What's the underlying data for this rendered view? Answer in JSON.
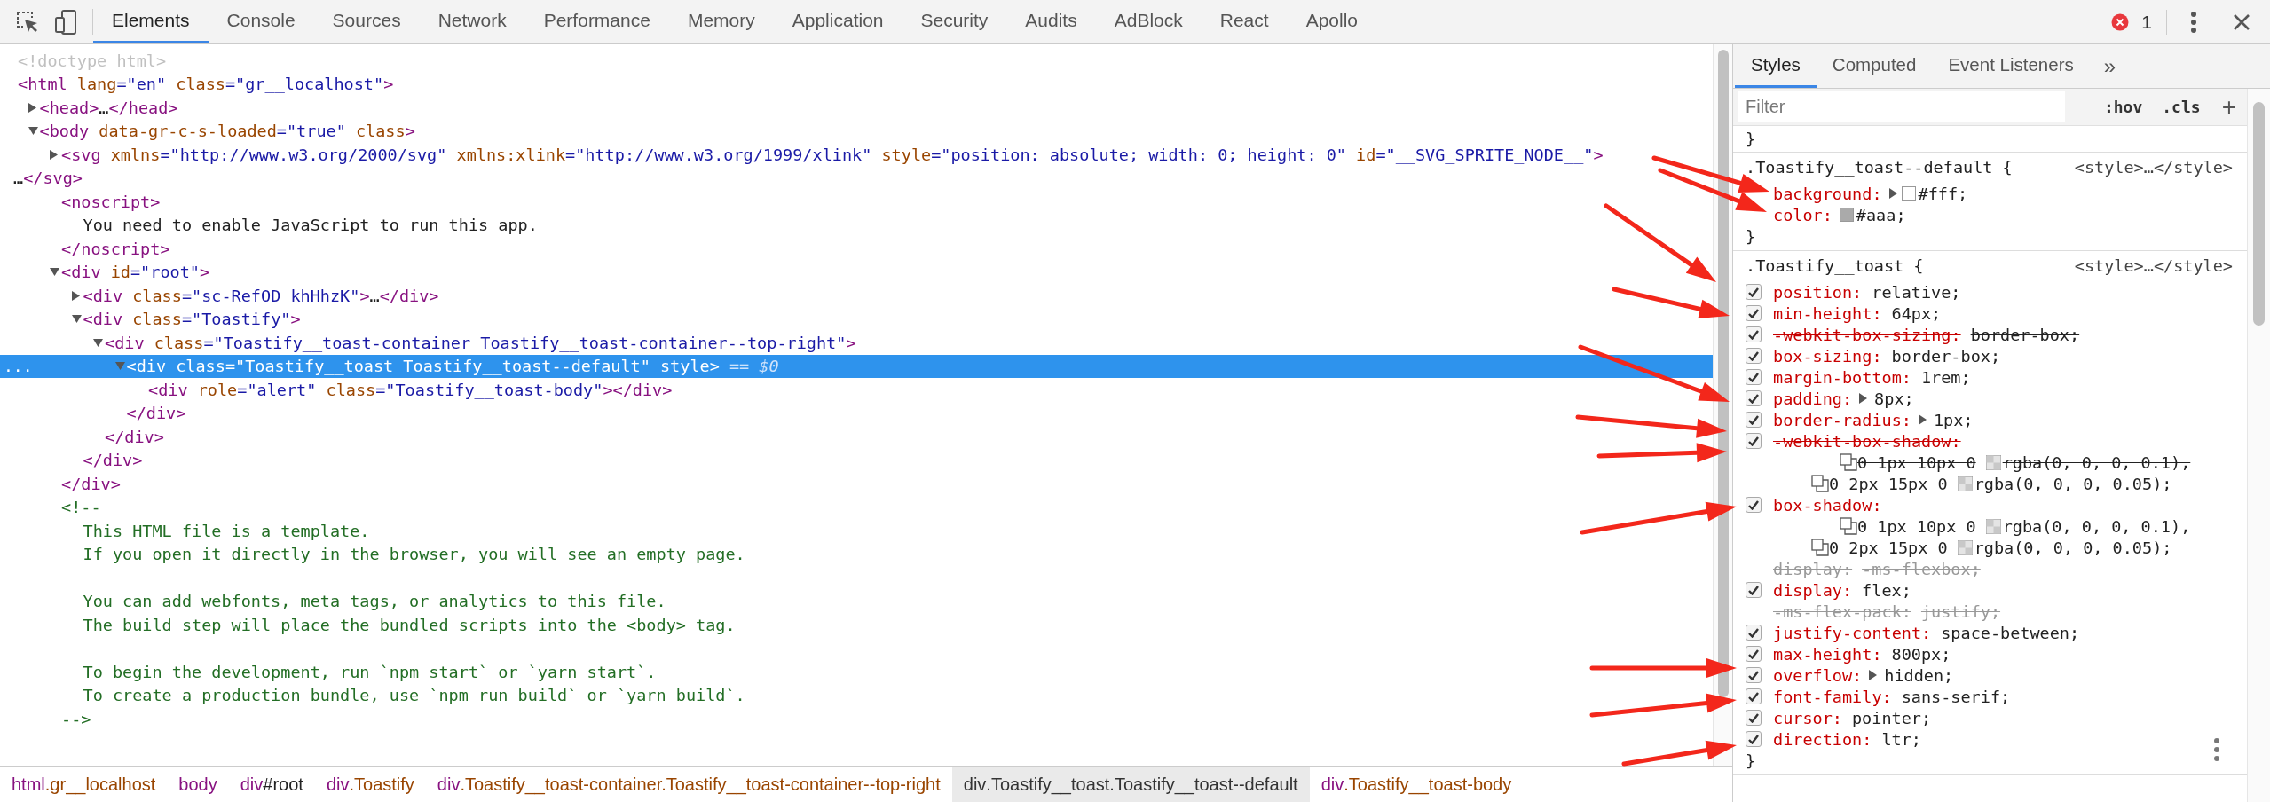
{
  "toolbar": {
    "tabs": [
      {
        "label": "Elements",
        "selected": true
      },
      {
        "label": "Console",
        "selected": false
      },
      {
        "label": "Sources",
        "selected": false
      },
      {
        "label": "Network",
        "selected": false
      },
      {
        "label": "Performance",
        "selected": false
      },
      {
        "label": "Memory",
        "selected": false
      },
      {
        "label": "Application",
        "selected": false
      },
      {
        "label": "Security",
        "selected": false
      },
      {
        "label": "Audits",
        "selected": false
      },
      {
        "label": "AdBlock",
        "selected": false
      },
      {
        "label": "React",
        "selected": false
      },
      {
        "label": "Apollo",
        "selected": false
      }
    ],
    "error_count": "1"
  },
  "elements": {
    "tree": [
      {
        "parts": [
          {
            "kind": "doctype",
            "text": "<!doctype html>"
          }
        ],
        "selected": false
      },
      {
        "parts": [
          {
            "kind": "tag",
            "text": "<html"
          },
          {
            "kind": "attr",
            "text": " lang"
          },
          {
            "kind": "value",
            "text": "=\"en\""
          },
          {
            "kind": "attr",
            "text": " class"
          },
          {
            "kind": "value",
            "text": "=\"gr__localhost\""
          },
          {
            "kind": "tag",
            "text": ">"
          }
        ],
        "selected": false,
        "children": [
          {
            "expanded": false,
            "parts": [
              {
                "kind": "tag",
                "text": "<head>"
              },
              {
                "kind": "text",
                "text": "…"
              },
              {
                "kind": "tag",
                "text": "</head>"
              }
            ],
            "selected": false
          },
          {
            "expanded": true,
            "parts": [
              {
                "kind": "tag",
                "text": "<body"
              },
              {
                "kind": "attr",
                "text": " data-gr-c-s-loaded"
              },
              {
                "kind": "value",
                "text": "=\"true\""
              },
              {
                "kind": "attr",
                "text": " class"
              },
              {
                "kind": "tag",
                "text": ">"
              }
            ],
            "selected": false,
            "children": [
              {
                "expanded": false,
                "parts": [
                  {
                    "kind": "tag",
                    "text": "<svg"
                  },
                  {
                    "kind": "attr",
                    "text": " xmlns"
                  },
                  {
                    "kind": "value",
                    "text": "=\"http://www.w3.org/2000/svg\""
                  },
                  {
                    "kind": "attr",
                    "text": " xmlns:xlink"
                  },
                  {
                    "kind": "value",
                    "text": "=\"http://www.w3.org/1999/xlink\""
                  },
                  {
                    "kind": "attr",
                    "text": " style"
                  },
                  {
                    "kind": "value",
                    "text": "=\"position: absolute; width: 0; height: 0\""
                  },
                  {
                    "kind": "attr",
                    "text": " id"
                  },
                  {
                    "kind": "value",
                    "text": "=\"__SVG_SPRITE_NODE__\""
                  },
                  {
                    "kind": "tag",
                    "text": ">"
                  }
                ],
                "wrapped": [
                  {
                    "kind": "text",
                    "text": "…"
                  },
                  {
                    "kind": "tag",
                    "text": "</svg>"
                  }
                ],
                "selected": false
              },
              {
                "parts": [
                  {
                    "kind": "tag",
                    "text": "<noscript>"
                  }
                ],
                "selected": false,
                "children": [
                  {
                    "parts": [
                      {
                        "kind": "text",
                        "text": "You need to enable JavaScript to run this app."
                      }
                    ],
                    "selected": false
                  }
                ],
                "close": [
                  {
                    "kind": "tag",
                    "text": "</noscript>"
                  }
                ]
              },
              {
                "expanded": true,
                "parts": [
                  {
                    "kind": "tag",
                    "text": "<div"
                  },
                  {
                    "kind": "attr",
                    "text": " id"
                  },
                  {
                    "kind": "value",
                    "text": "=\"root\""
                  },
                  {
                    "kind": "tag",
                    "text": ">"
                  }
                ],
                "selected": false,
                "children": [
                  {
                    "expanded": false,
                    "parts": [
                      {
                        "kind": "tag",
                        "text": "<div"
                      },
                      {
                        "kind": "attr",
                        "text": " class"
                      },
                      {
                        "kind": "value",
                        "text": "=\"sc-RefOD khHhzK\""
                      },
                      {
                        "kind": "tag",
                        "text": ">"
                      },
                      {
                        "kind": "text",
                        "text": "…"
                      },
                      {
                        "kind": "tag",
                        "text": "</div>"
                      }
                    ],
                    "selected": false
                  },
                  {
                    "expanded": true,
                    "parts": [
                      {
                        "kind": "tag",
                        "text": "<div"
                      },
                      {
                        "kind": "attr",
                        "text": " class"
                      },
                      {
                        "kind": "value",
                        "text": "=\"Toastify\""
                      },
                      {
                        "kind": "tag",
                        "text": ">"
                      }
                    ],
                    "selected": false,
                    "children": [
                      {
                        "expanded": true,
                        "parts": [
                          {
                            "kind": "tag",
                            "text": "<div"
                          },
                          {
                            "kind": "attr",
                            "text": " class"
                          },
                          {
                            "kind": "value",
                            "text": "=\"Toastify__toast-container Toastify__toast-container--top-right\""
                          },
                          {
                            "kind": "tag",
                            "text": ">"
                          }
                        ],
                        "selected": false,
                        "children": [
                          {
                            "expanded": true,
                            "gutter": "...",
                            "parts": [
                              {
                                "kind": "tag",
                                "text": "<div"
                              },
                              {
                                "kind": "attr",
                                "text": " class"
                              },
                              {
                                "kind": "value",
                                "text": "=\"Toastify__toast Toastify__toast--default\""
                              },
                              {
                                "kind": "attr",
                                "text": " style"
                              },
                              {
                                "kind": "tag",
                                "text": ">"
                              },
                              {
                                "kind": "marker",
                                "text": " == $0"
                              }
                            ],
                            "selected": true,
                            "children": [
                              {
                                "parts": [
                                  {
                                    "kind": "tag",
                                    "text": "<div"
                                  },
                                  {
                                    "kind": "attr",
                                    "text": " role"
                                  },
                                  {
                                    "kind": "value",
                                    "text": "=\"alert\""
                                  },
                                  {
                                    "kind": "attr",
                                    "text": " class"
                                  },
                                  {
                                    "kind": "value",
                                    "text": "=\"Toastify__toast-body\""
                                  },
                                  {
                                    "kind": "tag",
                                    "text": "></div>"
                                  }
                                ],
                                "selected": false
                              }
                            ],
                            "close": [
                              {
                                "kind": "tag",
                                "text": "</div>"
                              }
                            ]
                          }
                        ],
                        "close": [
                          {
                            "kind": "tag",
                            "text": "</div>"
                          }
                        ]
                      }
                    ],
                    "close": [
                      {
                        "kind": "tag",
                        "text": "</div>"
                      }
                    ]
                  }
                ],
                "close": [
                  {
                    "kind": "tag",
                    "text": "</div>"
                  }
                ]
              },
              {
                "parts": [
                  {
                    "kind": "comment",
                    "text": "<!--"
                  }
                ],
                "selected": false,
                "comment_lines": [
                  [
                    "This HTML file is a template.",
                    "If you open it directly in the browser, you will see an empty page."
                  ],
                  [
                    "You can add webfonts, meta tags, or analytics to this file.",
                    "The build step will place the bundled scripts into the <body> tag."
                  ],
                  [
                    "To begin the development, run `npm start` or `yarn start`.",
                    "To create a production bundle, use `npm run build` or `yarn build`."
                  ]
                ],
                "close": [
                  {
                    "kind": "comment",
                    "text": "-->"
                  }
                ]
              }
            ]
          }
        ]
      }
    ],
    "breadcrumbs": [
      {
        "tag": "html",
        "classes": ".gr__localhost",
        "selected": false
      },
      {
        "tag": "body",
        "selected": false
      },
      {
        "tag": "div",
        "id": "#root",
        "selected": false
      },
      {
        "tag": "div",
        "classes": ".Toastify",
        "selected": false
      },
      {
        "tag": "div",
        "classes": ".Toastify__toast-container.Toastify__toast-container--top-right",
        "selected": false
      },
      {
        "tag": "div",
        "classes": ".Toastify__toast.Toastify__toast--default",
        "selected": true
      },
      {
        "tag": "div",
        "classes": ".Toastify__toast-body",
        "selected": false
      }
    ]
  },
  "styles": {
    "tabs": [
      {
        "label": "Styles",
        "selected": true
      },
      {
        "label": "Computed",
        "selected": false
      },
      {
        "label": "Event Listeners",
        "selected": false
      }
    ],
    "more": "»",
    "filter": {
      "placeholder": "Filter"
    },
    "buttons": [
      ":hov",
      ".cls"
    ],
    "add": "+",
    "prev_close": "}",
    "rules": [
      {
        "selector": ".Toastify__toast--default {",
        "source": "<style>…</style>",
        "close": "}",
        "declarations": [
          {
            "name": "background:",
            "kind": "active",
            "expander": true,
            "color": "#ffffff",
            "value": "#fff;"
          },
          {
            "name": "color:",
            "kind": "active",
            "color": "#aaaaaa",
            "value": "#aaa;"
          }
        ]
      },
      {
        "selector": ".Toastify__toast {",
        "source": "<style>…</style>",
        "close": "}",
        "menu_button": true,
        "declarations": [
          {
            "name": "position:",
            "kind": "active",
            "checked": true,
            "value": "relative;"
          },
          {
            "name": "min-height:",
            "kind": "active",
            "checked": true,
            "value": "64px;"
          },
          {
            "name": "-webkit-box-sizing:",
            "kind": "overridden",
            "checked": true,
            "value": "border-box;"
          },
          {
            "name": "box-sizing:",
            "kind": "active",
            "checked": true,
            "value": "border-box;"
          },
          {
            "name": "margin-bottom:",
            "kind": "active",
            "checked": true,
            "value": "1rem;"
          },
          {
            "name": "padding:",
            "kind": "active",
            "checked": true,
            "expander": true,
            "value": "8px;"
          },
          {
            "name": "border-radius:",
            "kind": "active",
            "checked": true,
            "expander": true,
            "value": "1px;"
          },
          {
            "name": "-webkit-box-shadow:",
            "kind": "overridden",
            "checked": true,
            "shadows": [
              {
                "offsets": "0 1px 10px 0",
                "rgba": "rgba(0, 0, 0, 0.1),"
              },
              {
                "offsets": "0 2px 15px 0",
                "rgba": "rgba(0, 0, 0, 0.05);"
              }
            ]
          },
          {
            "name": "box-shadow:",
            "kind": "active",
            "checked": true,
            "shadows": [
              {
                "offsets": "0 1px 10px 0",
                "rgba": "rgba(0, 0, 0, 0.1),"
              },
              {
                "offsets": "0 2px 15px 0",
                "rgba": "rgba(0, 0, 0, 0.05);"
              }
            ]
          },
          {
            "name": "display:",
            "kind": "unsupported",
            "value": "-ms-flexbox;"
          },
          {
            "name": "display:",
            "kind": "active",
            "checked": true,
            "value": "flex;"
          },
          {
            "name": "-ms-flex-pack:",
            "kind": "unsupported",
            "value": "justify;"
          },
          {
            "name": "justify-content:",
            "kind": "active",
            "checked": true,
            "value": "space-between;"
          },
          {
            "name": "max-height:",
            "kind": "active",
            "checked": true,
            "value": "800px;"
          },
          {
            "name": "overflow:",
            "kind": "active",
            "checked": true,
            "expander": true,
            "value": "hidden;"
          },
          {
            "name": "font-family:",
            "kind": "active",
            "checked": true,
            "value": "sans-serif;"
          },
          {
            "name": "cursor:",
            "kind": "active",
            "checked": true,
            "value": "pointer;"
          },
          {
            "name": "direction:",
            "kind": "active",
            "checked": true,
            "value": "ltr;"
          }
        ]
      }
    ]
  }
}
